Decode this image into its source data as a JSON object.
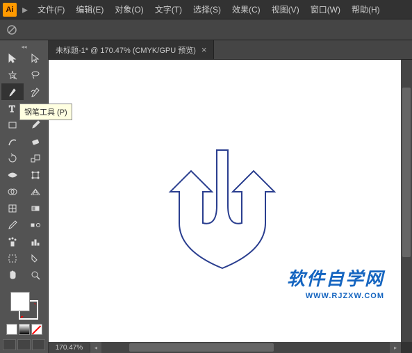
{
  "app": {
    "name": "Ai"
  },
  "menu": {
    "items": [
      "文件(F)",
      "编辑(E)",
      "对象(O)",
      "文字(T)",
      "选择(S)",
      "效果(C)",
      "视图(V)",
      "窗口(W)",
      "帮助(H)"
    ]
  },
  "document": {
    "tab_title": "未标题-1* @ 170.47% (CMYK/GPU 预览)",
    "zoom": "170.47%"
  },
  "tooltip": {
    "text": "钢笔工具 (P)"
  },
  "watermark": {
    "cn": "软件自学网",
    "url": "WWW.RJZXW.COM"
  },
  "tools": {
    "names": [
      "selection-tool",
      "direct-selection-tool",
      "magic-wand-tool",
      "lasso-tool",
      "pen-tool",
      "curvature-tool",
      "type-tool",
      "line-segment-tool",
      "rectangle-tool",
      "paintbrush-tool",
      "shaper-tool",
      "eraser-tool",
      "rotate-tool",
      "scale-tool",
      "width-tool",
      "free-transform-tool",
      "shape-builder-tool",
      "perspective-grid-tool",
      "mesh-tool",
      "gradient-tool",
      "eyedropper-tool",
      "blend-tool",
      "symbol-sprayer-tool",
      "column-graph-tool",
      "artboard-tool",
      "slice-tool",
      "hand-tool",
      "zoom-tool"
    ]
  },
  "colors": {
    "fill": "#ffffff",
    "stroke": "none"
  }
}
